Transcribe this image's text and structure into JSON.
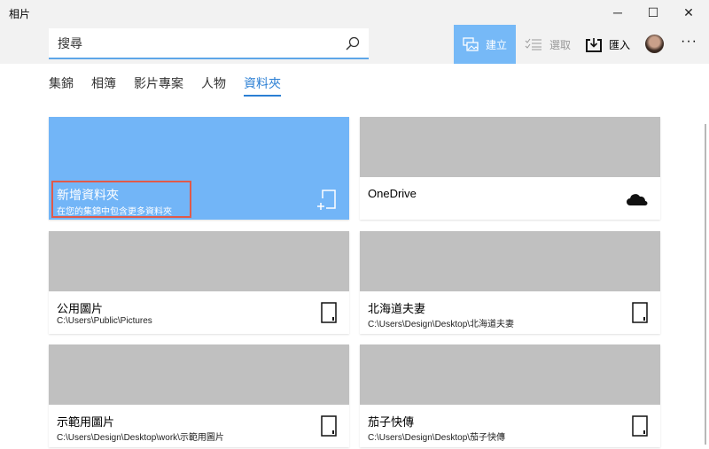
{
  "window": {
    "title": "相片",
    "minimize": "─",
    "maximize": "☐",
    "close": "✕"
  },
  "search": {
    "placeholder": "搜尋"
  },
  "toolbar": {
    "create": "建立",
    "select": "選取",
    "import": "匯入",
    "more": "···"
  },
  "tabs": [
    {
      "label": "集錦"
    },
    {
      "label": "相簿"
    },
    {
      "label": "影片專案"
    },
    {
      "label": "人物"
    },
    {
      "label": "資料夾",
      "active": true
    }
  ],
  "new_folder": {
    "title": "新增資料夾",
    "subtitle": "在您的集錦中包含更多資料夾"
  },
  "folders": [
    {
      "name": "OneDrive",
      "path": ""
    },
    {
      "name": "公用圖片",
      "path": "C:\\Users\\Public\\Pictures"
    },
    {
      "name": "北海道夫妻",
      "path": "C:\\Users\\Design\\Desktop\\北海道夫妻"
    },
    {
      "name": "示範用圖片",
      "path": "C:\\Users\\Design\\Desktop\\work\\示範用圖片"
    },
    {
      "name": "茄子快傳",
      "path": "C:\\Users\\Design\\Desktop\\茄子快傳"
    }
  ],
  "colors": {
    "accent": "#76b9f7",
    "highlight": "#e05a4a"
  }
}
